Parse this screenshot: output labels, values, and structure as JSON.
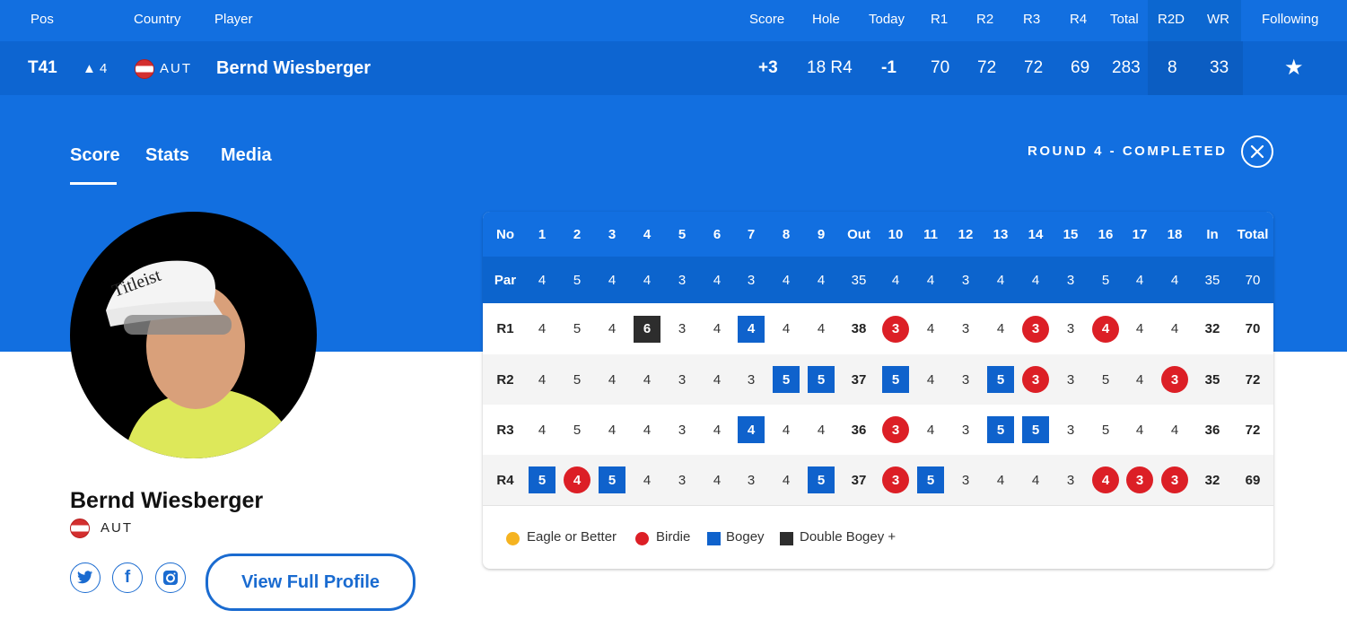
{
  "leaderboard": {
    "headers": {
      "pos": "Pos",
      "country": "Country",
      "player": "Player",
      "score": "Score",
      "hole": "Hole",
      "today": "Today",
      "r1": "R1",
      "r2": "R2",
      "r3": "R3",
      "r4": "R4",
      "total": "Total",
      "r2d": "R2D",
      "wr": "WR",
      "following": "Following"
    },
    "row": {
      "pos": "T41",
      "movement": "▲ 4",
      "country": "AUT",
      "player": "Bernd Wiesberger",
      "score": "+3",
      "hole": "18 R4",
      "today": "-1",
      "r1": "70",
      "r2": "72",
      "r3": "72",
      "r4": "69",
      "total": "283",
      "r2d": "8",
      "wr": "33",
      "following_icon": "star-icon"
    }
  },
  "tabs": [
    {
      "label": "Score",
      "active": true
    },
    {
      "label": "Stats",
      "active": false
    },
    {
      "label": "Media",
      "active": false
    }
  ],
  "round_status": "ROUND 4 - COMPLETED",
  "profile": {
    "name": "Bernd Wiesberger",
    "country": "AUT",
    "button": "View Full Profile",
    "social": [
      "twitter-icon",
      "facebook-icon",
      "instagram-icon"
    ]
  },
  "scorecard": {
    "header": [
      "No",
      "1",
      "2",
      "3",
      "4",
      "5",
      "6",
      "7",
      "8",
      "9",
      "Out",
      "10",
      "11",
      "12",
      "13",
      "14",
      "15",
      "16",
      "17",
      "18",
      "In",
      "Total"
    ],
    "par": [
      "Par",
      "4",
      "5",
      "4",
      "4",
      "3",
      "4",
      "3",
      "4",
      "4",
      "35",
      "4",
      "4",
      "3",
      "4",
      "4",
      "3",
      "5",
      "4",
      "4",
      "35",
      "70"
    ],
    "rounds": [
      {
        "label": "R1",
        "scores": [
          "4",
          "5",
          "4",
          "6",
          "3",
          "4",
          "4",
          "4",
          "4",
          "38",
          "3",
          "4",
          "3",
          "4",
          "3",
          "3",
          "4",
          "4",
          "4",
          "32",
          "70"
        ]
      },
      {
        "label": "R2",
        "scores": [
          "4",
          "5",
          "4",
          "4",
          "3",
          "4",
          "3",
          "5",
          "5",
          "37",
          "5",
          "4",
          "3",
          "5",
          "3",
          "3",
          "5",
          "4",
          "3",
          "35",
          "72"
        ]
      },
      {
        "label": "R3",
        "scores": [
          "4",
          "5",
          "4",
          "4",
          "3",
          "4",
          "4",
          "4",
          "4",
          "36",
          "3",
          "4",
          "3",
          "5",
          "5",
          "3",
          "5",
          "4",
          "4",
          "36",
          "72"
        ]
      },
      {
        "label": "R4",
        "scores": [
          "5",
          "4",
          "5",
          "4",
          "3",
          "4",
          "3",
          "4",
          "5",
          "37",
          "3",
          "5",
          "3",
          "4",
          "4",
          "3",
          "4",
          "3",
          "3",
          "32",
          "69"
        ]
      }
    ],
    "colors": {
      "eagle": "#f5b320",
      "birdie": "#dc1f26",
      "bogey": "#0f62cc",
      "double": "#2d2d2d"
    }
  },
  "legend": [
    {
      "label": "Eagle or Better",
      "shape": "circle",
      "color": "#f5b320"
    },
    {
      "label": "Birdie",
      "shape": "circle",
      "color": "#dc1f26"
    },
    {
      "label": "Bogey",
      "shape": "square",
      "color": "#0f62cc"
    },
    {
      "label": "Double Bogey +",
      "shape": "square",
      "color": "#2d2d2d"
    }
  ]
}
